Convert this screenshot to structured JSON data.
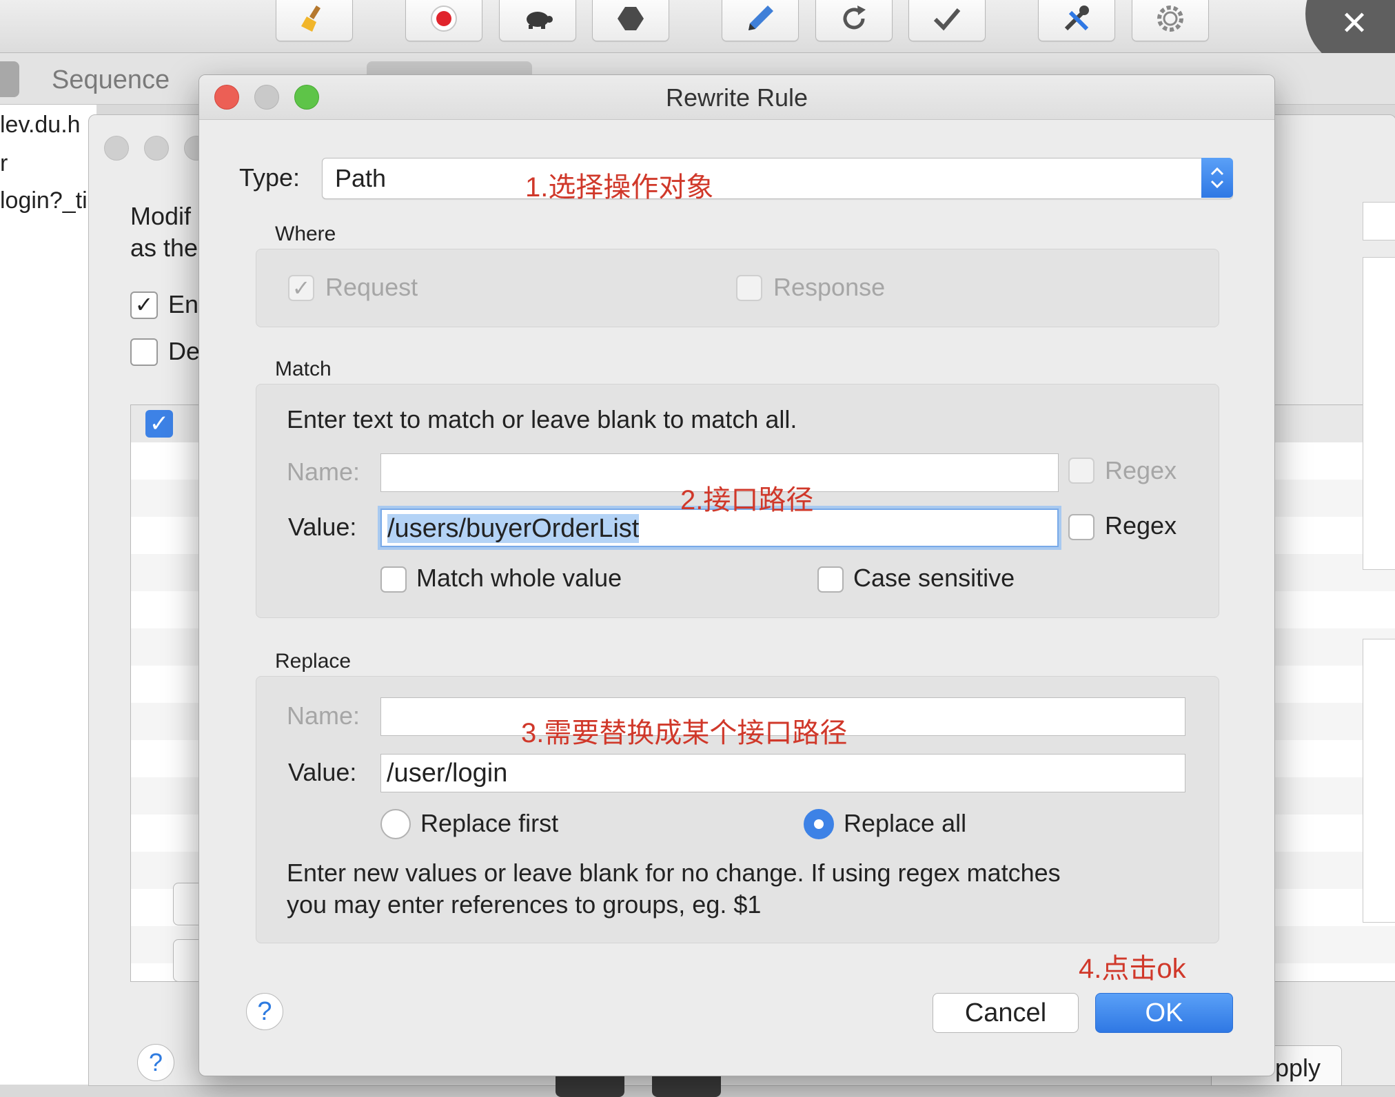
{
  "toolbar": {
    "icons": [
      "broom-icon",
      "record-icon",
      "turtle-icon",
      "stop-hexagon-icon",
      "pen-icon",
      "refresh-icon",
      "checkmark-icon",
      "tools-icon",
      "settings-gear-icon"
    ]
  },
  "background": {
    "tab_sequence": "Sequence",
    "left_list": [
      "lev.du.h",
      "r",
      "login?_ti"
    ],
    "mid_text_line1": "Modif",
    "mid_text_line2": "as the",
    "mid_enable": "En",
    "mid_debug": "De",
    "apply_label": "pply",
    "help_label": "?"
  },
  "dialog": {
    "title": "Rewrite Rule",
    "type_label": "Type:",
    "type_value": "Path",
    "where": {
      "title": "Where",
      "request": "Request",
      "response": "Response"
    },
    "match": {
      "title": "Match",
      "hint": "Enter text to match or leave blank to match all.",
      "name_label": "Name:",
      "name_value": "",
      "name_regex": "Regex",
      "value_label": "Value:",
      "value_value": "/users/buyerOrderList",
      "value_regex": "Regex",
      "match_whole": "Match whole value",
      "case_sensitive": "Case sensitive"
    },
    "replace": {
      "title": "Replace",
      "name_label": "Name:",
      "name_value": "",
      "value_label": "Value:",
      "value_value": "/user/login",
      "replace_first": "Replace first",
      "replace_all": "Replace all",
      "hint_line1": "Enter new values or leave blank for no change. If using regex matches",
      "hint_line2": "you may enter references to groups, eg. $1"
    },
    "help": "?",
    "cancel": "Cancel",
    "ok": "OK"
  },
  "annotations": {
    "a1": "1.选择操作对象",
    "a2": "2.接口路径",
    "a3": "3.需要替换成某个接口路径",
    "a4": "4.点击ok"
  },
  "colors": {
    "accent": "#3d82e6",
    "annotation": "#d0382a",
    "close_red": "#ec5f55",
    "minimize_gray": "#c9c9c9",
    "zoom_green": "#5ec448"
  }
}
